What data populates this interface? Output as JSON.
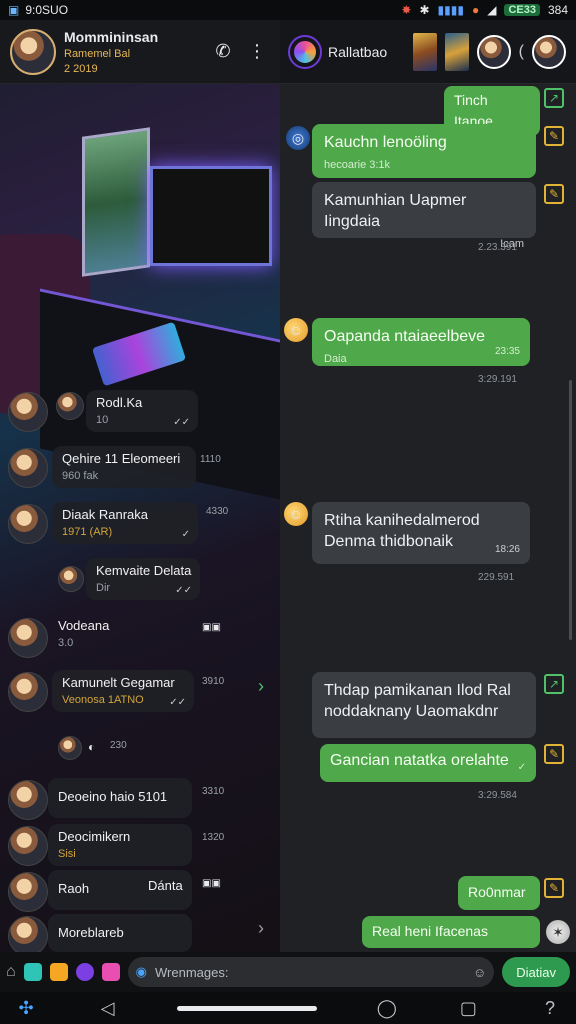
{
  "status_bar": {
    "time": "9:0SUO",
    "badge": "CE33",
    "battery": "384"
  },
  "left_header": {
    "name": "Mommininsan",
    "subtitle": "Ramemel Bal",
    "stars": "2 2019"
  },
  "chats": [
    {
      "title": "Rodl.Ka",
      "preview": "10",
      "time": ""
    },
    {
      "title": "Qehire 11 Eleomeeri",
      "preview": "960 fak",
      "time": "1110"
    },
    {
      "title": "Diaak Ranraka",
      "preview": "1971 (AR)",
      "time": "4330"
    },
    {
      "title": "Kemvaite Delata",
      "preview": "Dir",
      "time": ""
    },
    {
      "title": "Vodeana",
      "preview": "3.0",
      "time": ""
    },
    {
      "title": "Kamunelt Gegamar",
      "preview": "Veonosa 1ATNO",
      "time": "3910"
    },
    {
      "title": "",
      "preview": "",
      "time": "230"
    },
    {
      "title": "Deoeino haio 5101",
      "preview": "",
      "time": "3310"
    },
    {
      "title": "Deocimikern",
      "preview": "Sisi",
      "time": "1320"
    },
    {
      "title": "Raoh",
      "preview": "",
      "time": "Dánta"
    },
    {
      "title": "Moreblareb",
      "preview": "",
      "time": ""
    }
  ],
  "right_header": {
    "title": "Rallatbao"
  },
  "messages": [
    {
      "dir": "out",
      "text": "Tinch Itanoe",
      "meta": ""
    },
    {
      "dir": "out",
      "text": "Kauchn lenoöling",
      "meta": "hecoarie 3:1k"
    },
    {
      "dir": "in",
      "text": "Kamunhian Uapmer Iingdaia",
      "meta": "Icam",
      "time": "2.23.391"
    },
    {
      "dir": "out",
      "text": "Oapanda ntaiaeelbeve",
      "meta": "Daia",
      "time": "3:29.191",
      "stamp": "23:35"
    },
    {
      "dir": "in",
      "text": "Rtiha kanihedalmerod\nDenma thidbonaik",
      "meta": "",
      "time": "229.591",
      "stamp": "18:26"
    },
    {
      "dir": "in",
      "text": "Thdap pamikanan Ilod Ral\nnoddaknany Uaomakdnr",
      "meta": ""
    },
    {
      "dir": "out",
      "text": "Gancian natatka orelahte",
      "meta": "",
      "time": "3:29.584"
    },
    {
      "dir": "out",
      "text": "Ro0nmar",
      "meta": ""
    },
    {
      "dir": "out",
      "text": "Real heni Ifacenas",
      "meta": ""
    }
  ],
  "composer": {
    "placeholder": "Wrenmages:",
    "send_label": "Diatiav"
  },
  "colors": {
    "accent_green": "#4fa84a",
    "incoming": "#3a3d42",
    "badge_gold": "#e0b235"
  }
}
